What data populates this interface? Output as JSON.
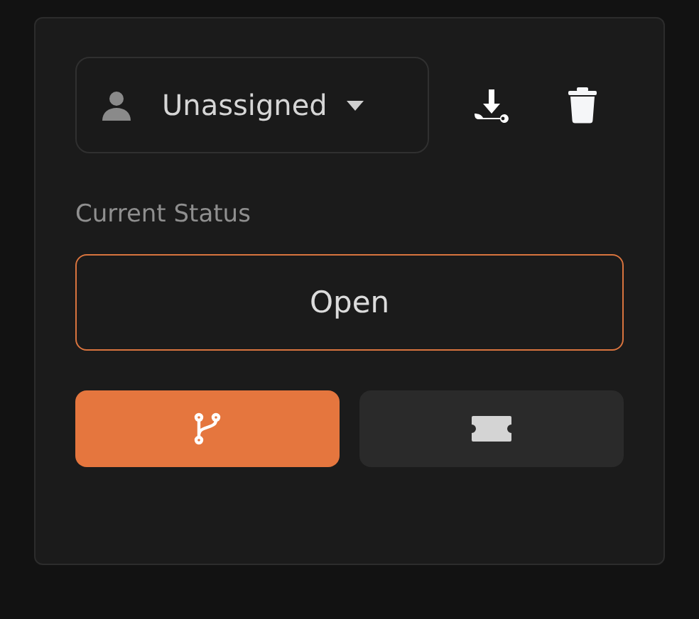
{
  "assignee": {
    "value": "Unassigned"
  },
  "status_label": "Current Status",
  "status": {
    "value": "Open"
  },
  "actions": [
    {
      "kind": "branch",
      "selected": true
    },
    {
      "kind": "ticket",
      "selected": false
    }
  ]
}
